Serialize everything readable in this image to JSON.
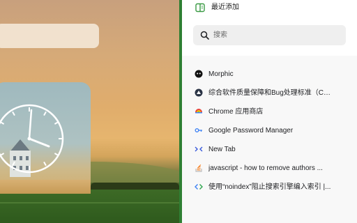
{
  "side_panel": {
    "title": "最近添加",
    "search": {
      "placeholder": "搜索"
    },
    "items": [
      {
        "label": "Morphic",
        "icon": "morphic-icon"
      },
      {
        "label": "综合软件质量保障和Bug处理标准（Co...",
        "icon": "circle-logo-icon"
      },
      {
        "label": "Chrome 应用商店",
        "icon": "chrome-web-store-icon"
      },
      {
        "label": "Google Password Manager",
        "icon": "key-icon"
      },
      {
        "label": "New Tab",
        "icon": "new-tab-icon"
      },
      {
        "label": "javascript - how to remove authors ...",
        "icon": "stack-overflow-icon"
      },
      {
        "label": "使用“noindex”阻止搜索引擎编入索引 |...",
        "icon": "code-brackets-icon"
      }
    ]
  },
  "colors": {
    "panel_accent": "#2f7f33",
    "header_icon": "#3a9a44",
    "search_bg": "#efefef",
    "list_bg": "#f8f8f8"
  }
}
